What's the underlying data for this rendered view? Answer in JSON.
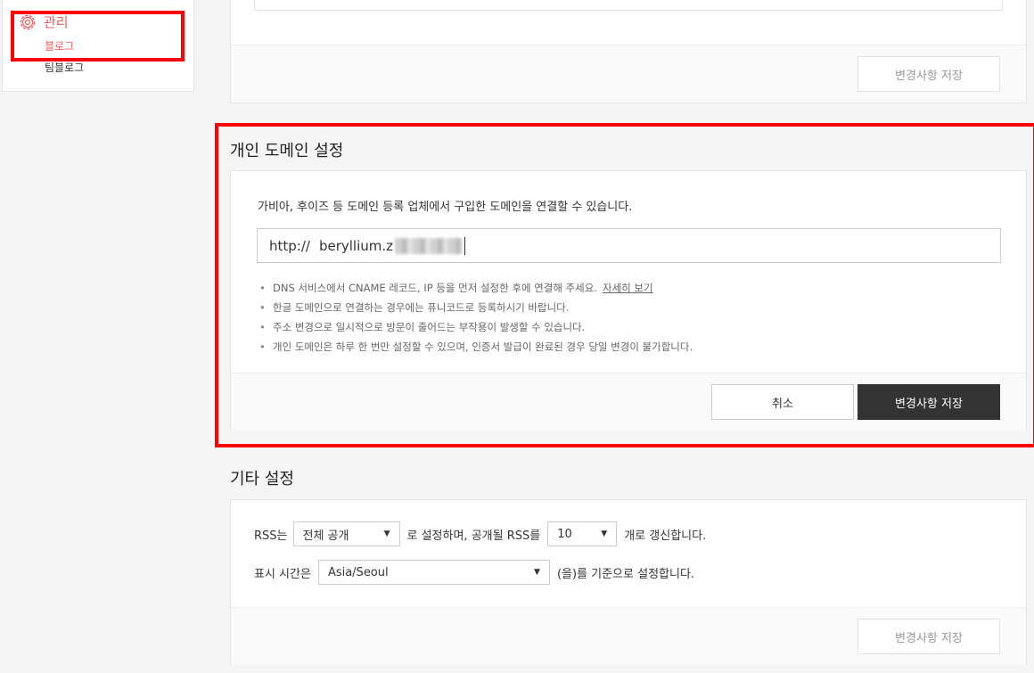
{
  "sidebar": {
    "group_label": "관리",
    "items": [
      {
        "label": "블로그",
        "active": true
      },
      {
        "label": "팀블로그",
        "active": false
      }
    ]
  },
  "top_card": {
    "save_label": "변경사항 저장"
  },
  "domain_section": {
    "title": "개인 도메인 설정",
    "description": "가비아, 후이즈 등 도메인 등록 업체에서 구입한 도메인을 연결할 수 있습니다.",
    "input_prefix": "http://",
    "input_value": "beryllium.z",
    "notes": [
      "DNS 서비스에서 CNAME 레코드, IP 등을 먼저 설정한 후에 연결해 주세요.",
      "한글 도메인으로 연결하는 경우에는 퓨니코드로 등록하시기 바랍니다.",
      "주소 변경으로 일시적으로 방문이 줄어드는 부작용이 발생할 수 있습니다.",
      "개인 도메인은 하루 한 번만 설정할 수 있으며, 인증서 발급이 완료된 경우 당일 변경이 불가합니다."
    ],
    "detail_link": "자세히 보기",
    "cancel_label": "취소",
    "save_label": "변경사항 저장"
  },
  "etc_section": {
    "title": "기타 설정",
    "rss_prefix": "RSS는",
    "rss_select": "전체 공개",
    "rss_middle": "로 설정하며, 공개될 RSS를",
    "rss_count_select": "10",
    "rss_suffix": "개로 갱신합니다.",
    "time_prefix": "표시 시간은",
    "time_select": "Asia/Seoul",
    "time_suffix": "(을)를 기준으로 설정합니다.",
    "save_label": "변경사항 저장"
  },
  "colors": {
    "accent": "#f05d5d",
    "highlight": "#ff0000",
    "primary_button": "#333333"
  }
}
